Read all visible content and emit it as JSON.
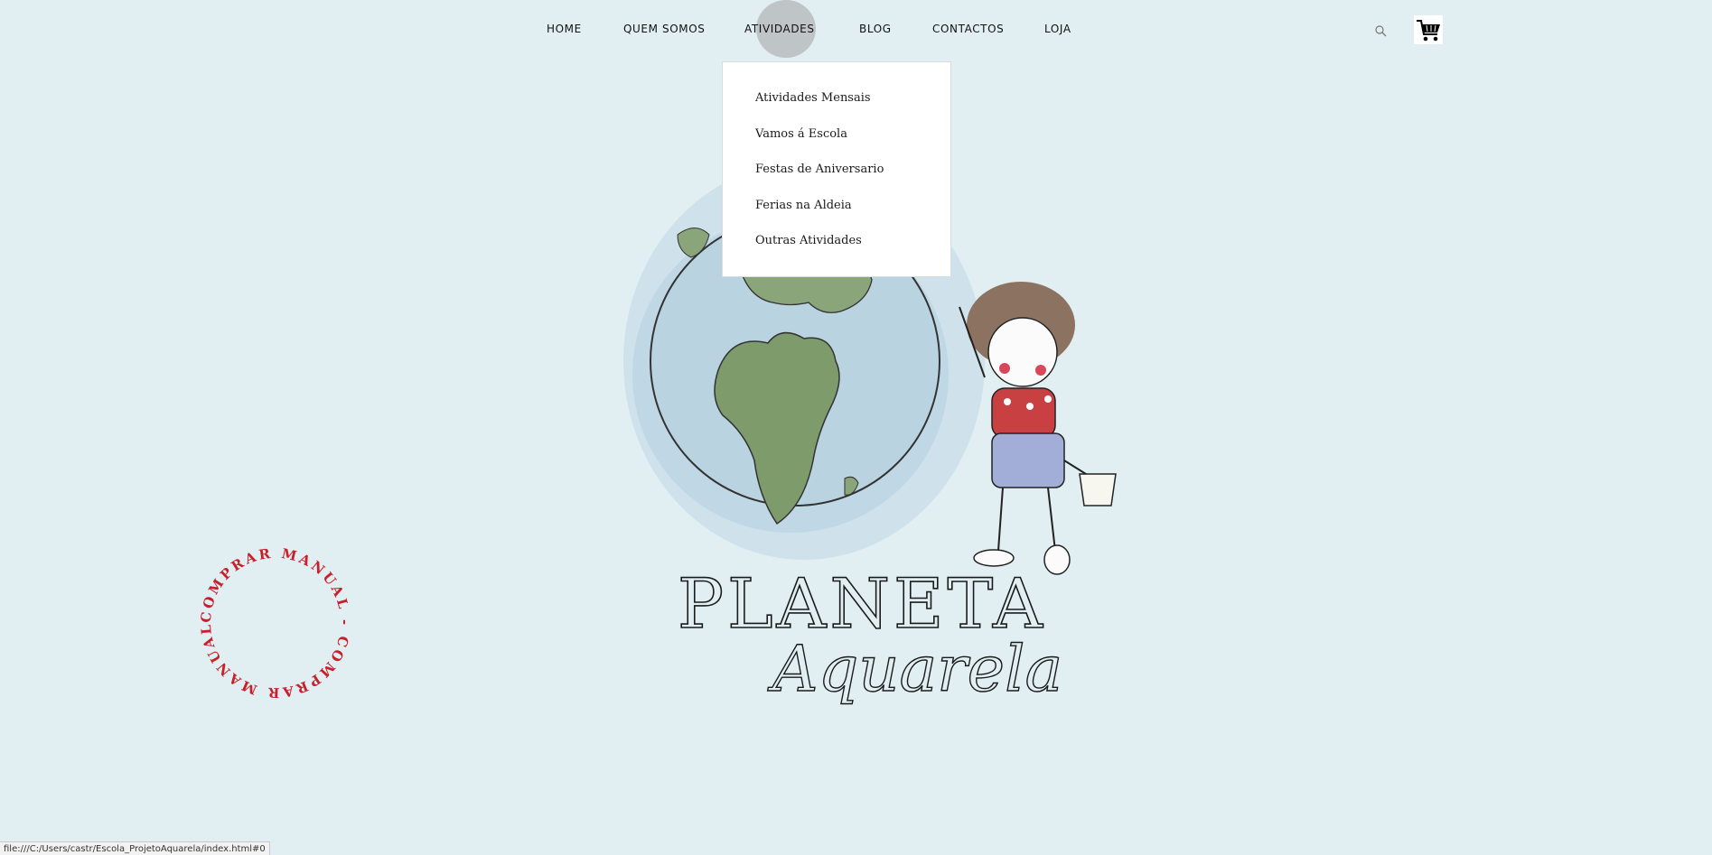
{
  "nav": {
    "items": [
      {
        "label": "HOME"
      },
      {
        "label": "QUEM SOMOS"
      },
      {
        "label": "ATIVIDADES"
      },
      {
        "label": "BLOG"
      },
      {
        "label": "CONTACTOS"
      },
      {
        "label": "LOJA"
      }
    ],
    "active": "ATIVIDADES",
    "icons": {
      "search": "search-icon",
      "cart": "cart-icon"
    }
  },
  "dropdown": {
    "items": [
      {
        "label": "Atividades Mensais"
      },
      {
        "label": "Vamos á Escola"
      },
      {
        "label": "Festas de Aniversario"
      },
      {
        "label": "Ferias na Aldeia"
      },
      {
        "label": "Outras Atividades"
      }
    ]
  },
  "hero": {
    "logo_line1": "PLANETA",
    "logo_line2": "Aquarela"
  },
  "badge": {
    "text": "COMPRAR MANUAL - COMPRAR MANUAL - ",
    "color": "#c8202a"
  },
  "statusbar": {
    "url": "file:///C:/Users/castr/Escola_ProjetoAquarela/index.html#0"
  },
  "colors": {
    "background": "#e1eff3",
    "accent_red": "#c8202a",
    "hover_circle": "#bfc4c6"
  }
}
